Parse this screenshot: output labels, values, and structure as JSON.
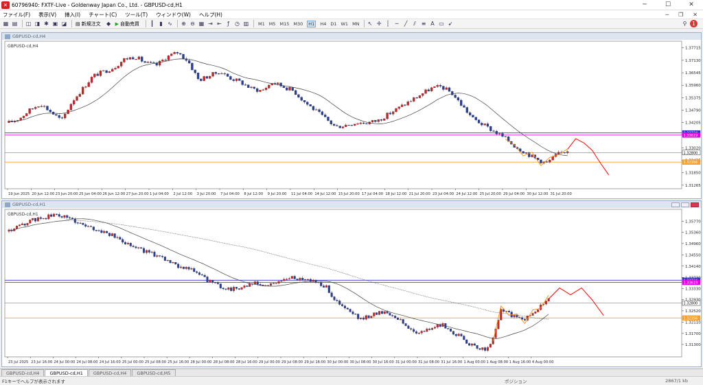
{
  "window": {
    "title": "60796940: FXTF-Live - Goldenway Japan Co., Ltd. - GBPUSD-cd,H1"
  },
  "menu": [
    "ファイル(F)",
    "表示(V)",
    "挿入(I)",
    "チャート(C)",
    "ツール(T)",
    "ウィンドウ(W)",
    "ヘルプ(H)"
  ],
  "toolbar": {
    "new_order": "新規注文",
    "auto_trade": "自動売買",
    "timeframes": [
      "M1",
      "M5",
      "M15",
      "M30",
      "H1",
      "H4",
      "D1",
      "W1",
      "MN"
    ],
    "active_timeframe": "H1"
  },
  "colors": {
    "bull": "#2d2d2d",
    "bear": "#2b3f93",
    "bull_body": "#c0292b",
    "ma_fast": "#404040",
    "ma_slow": "#606060",
    "forecast": "#ff0000",
    "zigzag": "#ff8c00",
    "line_blue": "#3333cc",
    "line_magenta": "#e000e0",
    "line_orange": "#f5b042"
  },
  "charts": [
    {
      "caption": "GBPUSD-cd,H4",
      "label": "GBPUSD-cd,H4",
      "price_min": 1.311,
      "price_max": 1.379,
      "price_ticks": [
        "1.37715",
        "1.37130",
        "1.36545",
        "1.35960",
        "1.35375",
        "1.34790",
        "1.34205",
        "1.33620",
        "1.33020",
        "1.32435",
        "1.31850",
        "1.31265"
      ],
      "markers": [
        {
          "value": 1.3372,
          "text": "1.33724",
          "color": "#3333cc"
        },
        {
          "value": 1.3362,
          "text": "1.33619",
          "color": "#e000e0"
        },
        {
          "value": 1.328,
          "text": "1.32800",
          "color": "#333333"
        },
        {
          "value": 1.3235,
          "text": "1.32356",
          "color": "#f5a030"
        }
      ],
      "time_labels": [
        "19 Jun 2025",
        "20 Jun 12:00",
        "23 Jun 20:00",
        "25 Jun 04:00",
        "26 Jun 12:00",
        "27 Jun 20:00",
        "1 Jul 04:00",
        "2 Jul 12:00",
        "3 Jul 20:00",
        "7 Jul 04:00",
        "8 Jul 12:00",
        "9 Jul 20:00",
        "11 Jul 04:00",
        "14 Jul 12:00",
        "15 Jul 20:00",
        "17 Jul 04:00",
        "18 Jul 12:00",
        "21 Jul 20:00",
        "23 Jul 04:00",
        "24 Jul 12:00",
        "25 Jul 20:00",
        "29 Jul 04:00",
        "30 Jul 12:00",
        "31 Jul 20:00"
      ],
      "path": [
        1.342,
        1.344,
        1.348,
        1.351,
        1.347,
        1.343,
        1.352,
        1.358,
        1.364,
        1.366,
        1.368,
        1.372,
        1.373,
        1.37,
        1.369,
        1.373,
        1.375,
        1.371,
        1.362,
        1.364,
        1.366,
        1.363,
        1.361,
        1.358,
        1.357,
        1.361,
        1.359,
        1.357,
        1.352,
        1.348,
        1.344,
        1.34,
        1.341,
        1.342,
        1.342,
        1.343,
        1.346,
        1.349,
        1.352,
        1.355,
        1.358,
        1.359,
        1.356,
        1.35,
        1.344,
        1.341,
        1.338,
        1.335,
        1.331,
        1.328,
        1.325,
        1.323,
        1.327,
        1.329
      ],
      "forecast": [
        1.3295,
        1.3345,
        1.3325,
        1.329,
        1.323,
        1.3175
      ]
    },
    {
      "caption": "GBPUSD-cd,H1",
      "label": "GBPUSD-cd,H1",
      "price_min": 1.3085,
      "price_max": 1.361,
      "price_ticks": [
        "1.35770",
        "1.35360",
        "1.34960",
        "1.34550",
        "1.34140",
        "1.33730",
        "1.33330",
        "1.32930",
        "1.32520",
        "1.32110",
        "1.31700",
        "1.31300"
      ],
      "markers": [
        {
          "value": 1.3363,
          "text": "1.33724",
          "color": "#3333cc"
        },
        {
          "value": 1.3355,
          "text": "1.33619",
          "color": "#e000e0"
        },
        {
          "value": 1.328,
          "text": "1.32800",
          "color": "#333333"
        },
        {
          "value": 1.3226,
          "text": "1.32356",
          "color": "#f5a030"
        }
      ],
      "time_labels": [
        "23 Jul 2025",
        "23 Jul 16:00",
        "24 Jul 00:00",
        "24 Jul 08:00",
        "24 Jul 16:00",
        "25 Jul 00:00",
        "25 Jul 08:00",
        "25 Jul 16:00",
        "28 Jul 00:00",
        "28 Jul 08:00",
        "28 Jul 16:00",
        "29 Jul 00:00",
        "29 Jul 08:00",
        "29 Jul 16:00",
        "30 Jul 00:00",
        "30 Jul 08:00",
        "30 Jul 16:00",
        "31 Jul 00:00",
        "31 Jul 08:00",
        "31 Jul 16:00",
        "1 Aug 00:00",
        "1 Aug 08:00",
        "1 Aug 16:00",
        "4 Aug 00:00"
      ],
      "path": [
        1.354,
        1.356,
        1.358,
        1.359,
        1.36,
        1.359,
        1.357,
        1.355,
        1.354,
        1.352,
        1.35,
        1.348,
        1.346,
        1.345,
        1.342,
        1.341,
        1.339,
        1.336,
        1.334,
        1.333,
        1.334,
        1.335,
        1.334,
        1.336,
        1.337,
        1.337,
        1.336,
        1.334,
        1.328,
        1.325,
        1.322,
        1.324,
        1.325,
        1.323,
        1.319,
        1.317,
        1.319,
        1.32,
        1.317,
        1.314,
        1.311,
        1.312,
        1.326,
        1.323,
        1.322,
        1.326,
        1.329
      ],
      "forecast": [
        1.3295,
        1.3335,
        1.331,
        1.3335,
        1.329,
        1.3235
      ]
    }
  ],
  "tabs": [
    "GBPUSD-cd,H4",
    "GBPUSD-cd,H1",
    "GBPUSD-cd,H4",
    "GBPUSD-cd,M5"
  ],
  "active_tab": 1,
  "status": {
    "left": "F1キーでヘルプが表示されます",
    "mid": "ポジション",
    "right": "2867/1 kb"
  }
}
